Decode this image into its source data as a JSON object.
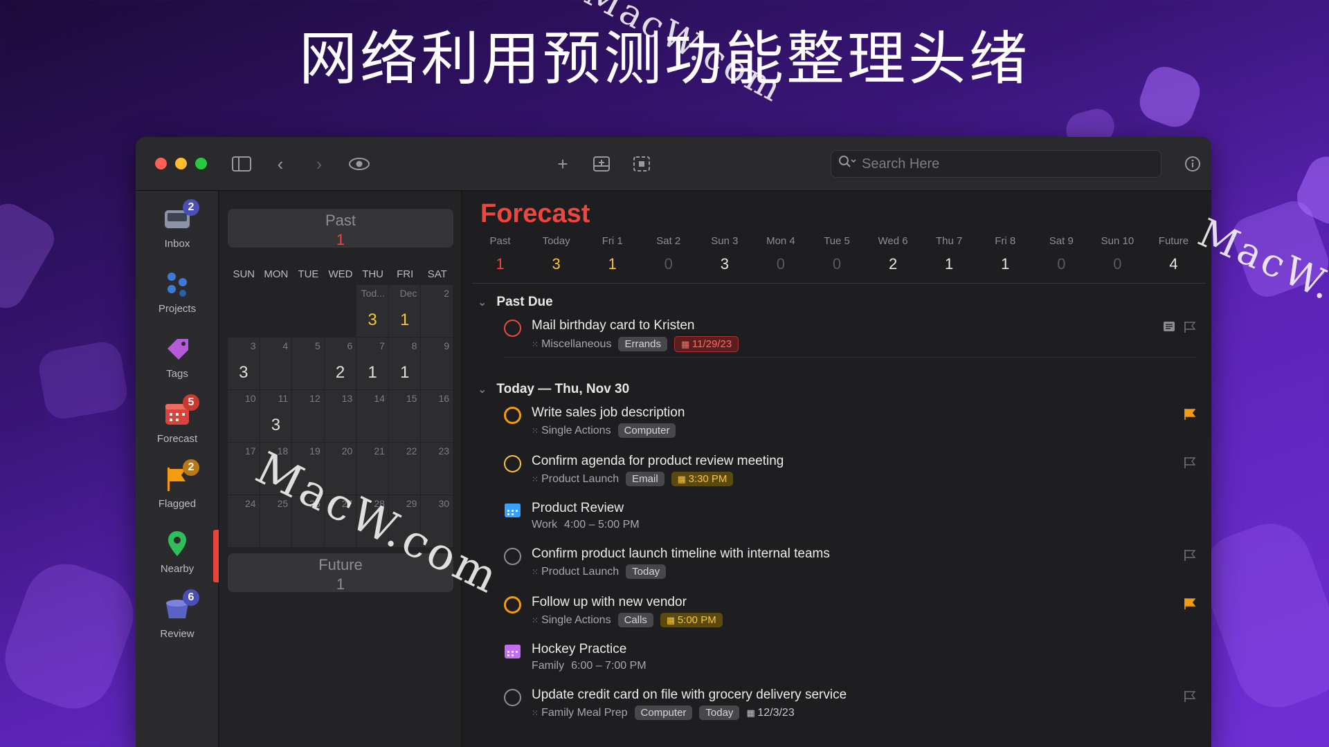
{
  "banner": {
    "title": "网络利用预测功能整理头绪"
  },
  "watermarks": [
    "MacW.com",
    "MacW.com",
    "MacW.com"
  ],
  "colors": {
    "accent_red": "#f0463e",
    "yellow": "#f6c443",
    "flag_orange": "#f39c12"
  },
  "toolbar": {
    "search_placeholder": "Search Here"
  },
  "sidebar": {
    "items": [
      {
        "label": "Inbox",
        "badge": "2",
        "icon": "inbox-icon"
      },
      {
        "label": "Projects",
        "badge": "",
        "icon": "projects-icon"
      },
      {
        "label": "Tags",
        "badge": "",
        "icon": "tag-icon"
      },
      {
        "label": "Forecast",
        "badge": "5",
        "icon": "calendar-icon"
      },
      {
        "label": "Flagged",
        "badge": "2",
        "icon": "flag-icon"
      },
      {
        "label": "Nearby",
        "badge": "",
        "icon": "location-pin-icon"
      },
      {
        "label": "Review",
        "badge": "6",
        "icon": "review-icon"
      }
    ]
  },
  "calendar": {
    "past": {
      "label": "Past",
      "count": "1"
    },
    "future": {
      "label": "Future",
      "count": "1"
    },
    "weekdays": [
      "SUN",
      "MON",
      "TUE",
      "WED",
      "THU",
      "FRI",
      "SAT"
    ],
    "rows": [
      [
        {
          "d": "",
          "n": ""
        },
        {
          "d": "",
          "n": ""
        },
        {
          "d": "",
          "n": ""
        },
        {
          "d": "",
          "n": ""
        },
        {
          "d": "Tod...",
          "n": "3",
          "y": true
        },
        {
          "d": "Dec",
          "n": "1",
          "y": true
        },
        {
          "d": "2",
          "n": ""
        }
      ],
      [
        {
          "d": "3",
          "n": "3"
        },
        {
          "d": "4",
          "n": ""
        },
        {
          "d": "5",
          "n": ""
        },
        {
          "d": "6",
          "n": "2"
        },
        {
          "d": "7",
          "n": "1"
        },
        {
          "d": "8",
          "n": "1"
        },
        {
          "d": "9",
          "n": ""
        }
      ],
      [
        {
          "d": "10",
          "n": ""
        },
        {
          "d": "11",
          "n": "3"
        },
        {
          "d": "12",
          "n": ""
        },
        {
          "d": "13",
          "n": ""
        },
        {
          "d": "14",
          "n": ""
        },
        {
          "d": "15",
          "n": ""
        },
        {
          "d": "16",
          "n": ""
        }
      ],
      [
        {
          "d": "17",
          "n": ""
        },
        {
          "d": "18",
          "n": ""
        },
        {
          "d": "19",
          "n": ""
        },
        {
          "d": "20",
          "n": ""
        },
        {
          "d": "21",
          "n": ""
        },
        {
          "d": "22",
          "n": ""
        },
        {
          "d": "23",
          "n": ""
        }
      ],
      [
        {
          "d": "24",
          "n": ""
        },
        {
          "d": "25",
          "n": ""
        },
        {
          "d": "26",
          "n": ""
        },
        {
          "d": "27",
          "n": ""
        },
        {
          "d": "28",
          "n": ""
        },
        {
          "d": "29",
          "n": ""
        },
        {
          "d": "30",
          "n": ""
        }
      ]
    ]
  },
  "forecast": {
    "title": "Forecast",
    "strip": [
      {
        "label": "Past",
        "count": "1",
        "color": "#f0463e"
      },
      {
        "label": "Today",
        "count": "3",
        "color": "#f6c443"
      },
      {
        "label": "Fri 1",
        "count": "1",
        "color": "#f6c443"
      },
      {
        "label": "Sat 2",
        "count": "0",
        "color": "#5a5a5e"
      },
      {
        "label": "Sun 3",
        "count": "3",
        "color": "#e8e8e8"
      },
      {
        "label": "Mon 4",
        "count": "0",
        "color": "#5a5a5e"
      },
      {
        "label": "Tue 5",
        "count": "0",
        "color": "#5a5a5e"
      },
      {
        "label": "Wed 6",
        "count": "2",
        "color": "#e8e8e8"
      },
      {
        "label": "Thu 7",
        "count": "1",
        "color": "#e8e8e8"
      },
      {
        "label": "Fri 8",
        "count": "1",
        "color": "#e8e8e8"
      },
      {
        "label": "Sat 9",
        "count": "0",
        "color": "#5a5a5e"
      },
      {
        "label": "Sun 10",
        "count": "0",
        "color": "#5a5a5e"
      },
      {
        "label": "Future",
        "count": "4",
        "color": "#e8e8e8"
      }
    ],
    "past_due_header": "Past Due",
    "today_header": "Today — Thu, Nov 30",
    "tasks": [
      {
        "title": "Mail birthday card to Kristen",
        "project": "Miscellaneous",
        "tags": [
          "Errands"
        ],
        "date": "11/29/23",
        "date_style": "red",
        "circle": "red",
        "flag": "outline",
        "note": true
      },
      {
        "title": "Write sales job description",
        "project": "Single Actions",
        "tags": [
          "Computer"
        ],
        "date": "",
        "circle": "orange-flag",
        "flag": "orange"
      },
      {
        "title": "Confirm agenda for product review meeting",
        "project": "Product Launch",
        "tags": [
          "Email"
        ],
        "date": "3:30 PM",
        "date_style": "yellow",
        "circle": "yellow",
        "flag": "outline"
      },
      {
        "title": "Product Review",
        "project": "Work",
        "time": "4:00 – 5:00 PM",
        "event": true,
        "event_color": "#3aa0ff"
      },
      {
        "title": "Confirm product launch timeline with internal teams",
        "project": "Product Launch",
        "tags": [
          "Today"
        ],
        "date": "",
        "circle": "gray",
        "flag": "outline"
      },
      {
        "title": "Follow up with new vendor",
        "project": "Single Actions",
        "tags": [
          "Calls"
        ],
        "date": "5:00 PM",
        "date_style": "yellow",
        "circle": "orange-flag",
        "flag": "orange"
      },
      {
        "title": "Hockey Practice",
        "project": "Family",
        "time": "6:00 – 7:00 PM",
        "event": true,
        "event_color": "#c46cf0"
      },
      {
        "title": "Update credit card on file with grocery delivery service",
        "project": "Family Meal Prep",
        "tags": [
          "Computer",
          "Today"
        ],
        "date": "12/3/23",
        "date_style": "plain",
        "circle": "gray",
        "flag": "outline"
      }
    ]
  }
}
